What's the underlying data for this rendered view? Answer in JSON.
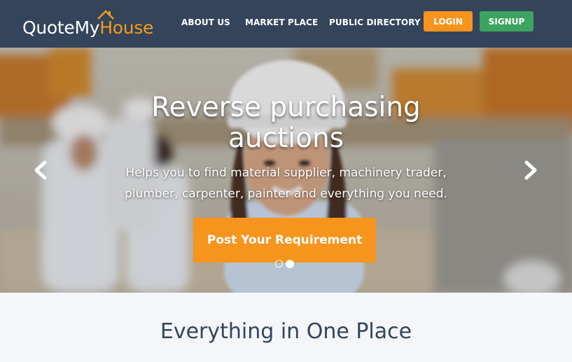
{
  "brand": {
    "part1": "QuoteMy",
    "part2": "House"
  },
  "nav": {
    "about": "ABOUT US",
    "market": "MARKET PLACE",
    "directory": "PUBLIC DIRECTORY",
    "login": "LOGIN",
    "signup": "SIGNUP"
  },
  "hero": {
    "title_line1": "Reverse purchasing",
    "title_line2": "auctions",
    "sub_line1": "Helps you to find material supplier, machinery trader,",
    "sub_line2": "plumber, carpenter, painter and everything you need.",
    "cta": "Post Your Requirement",
    "slides_total": 2,
    "active_slide": 2
  },
  "section": {
    "title": "Everything in One Place"
  },
  "colors": {
    "navbar": "#34445a",
    "accent_orange": "#f7941d",
    "accent_green": "#3ca45f",
    "section_bg": "#f4f6f9",
    "heading": "#34445a"
  },
  "icons": [
    "house-roof-icon",
    "chevron-left-icon",
    "chevron-right-icon"
  ]
}
